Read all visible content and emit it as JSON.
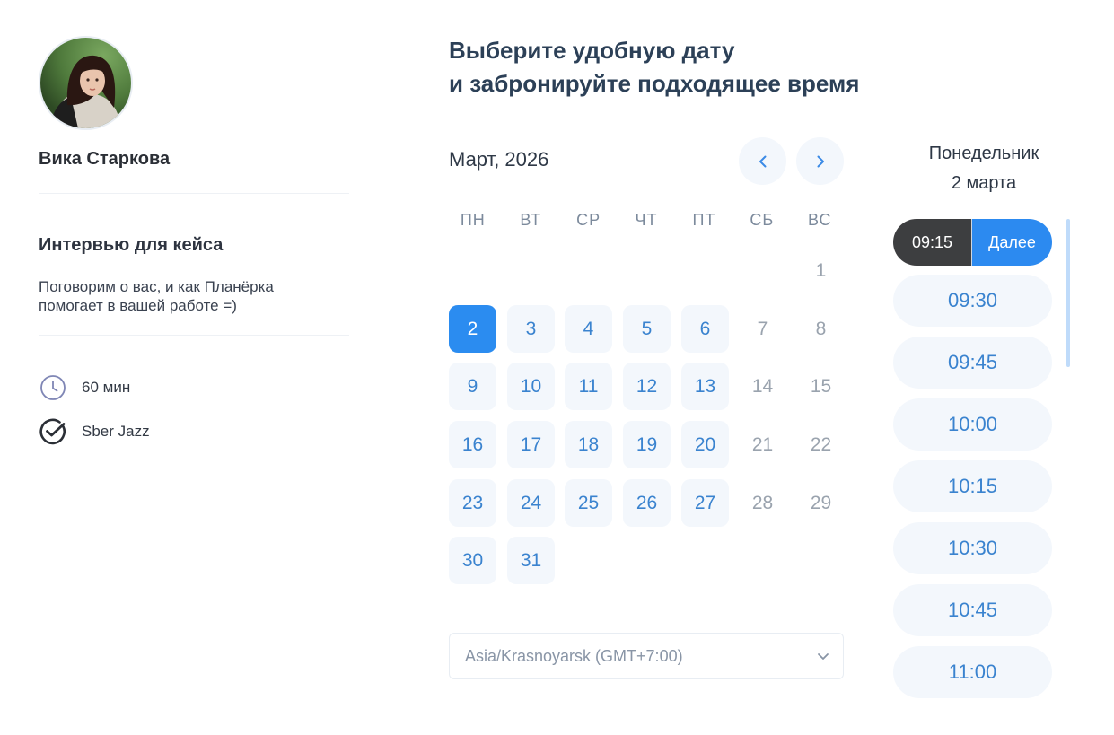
{
  "host": {
    "name": "Вика Старкова"
  },
  "event": {
    "title": "Интервью для кейса",
    "description_line1": "Поговорим о вас, и как Планёрка",
    "description_line2": "помогает в вашей работе =)",
    "duration": "60 мин",
    "platform": "Sber Jazz"
  },
  "heading": {
    "line1": "Выберите удобную дату",
    "line2": "и забронируйте подходящее время"
  },
  "calendar": {
    "month_label": "Март, 2026",
    "weekdays": [
      "ПН",
      "ВТ",
      "СР",
      "ЧТ",
      "ПТ",
      "СБ",
      "ВС"
    ],
    "selected_day": "2",
    "days": [
      {
        "label": "1",
        "col": 6,
        "row": 0,
        "state": "unavailable"
      },
      {
        "label": "2",
        "col": 0,
        "row": 1,
        "state": "selected"
      },
      {
        "label": "3",
        "col": 1,
        "row": 1,
        "state": "available"
      },
      {
        "label": "4",
        "col": 2,
        "row": 1,
        "state": "available"
      },
      {
        "label": "5",
        "col": 3,
        "row": 1,
        "state": "available"
      },
      {
        "label": "6",
        "col": 4,
        "row": 1,
        "state": "available"
      },
      {
        "label": "7",
        "col": 5,
        "row": 1,
        "state": "unavailable"
      },
      {
        "label": "8",
        "col": 6,
        "row": 1,
        "state": "unavailable"
      },
      {
        "label": "9",
        "col": 0,
        "row": 2,
        "state": "available"
      },
      {
        "label": "10",
        "col": 1,
        "row": 2,
        "state": "available"
      },
      {
        "label": "11",
        "col": 2,
        "row": 2,
        "state": "available"
      },
      {
        "label": "12",
        "col": 3,
        "row": 2,
        "state": "available"
      },
      {
        "label": "13",
        "col": 4,
        "row": 2,
        "state": "available"
      },
      {
        "label": "14",
        "col": 5,
        "row": 2,
        "state": "unavailable"
      },
      {
        "label": "15",
        "col": 6,
        "row": 2,
        "state": "unavailable"
      },
      {
        "label": "16",
        "col": 0,
        "row": 3,
        "state": "available"
      },
      {
        "label": "17",
        "col": 1,
        "row": 3,
        "state": "available"
      },
      {
        "label": "18",
        "col": 2,
        "row": 3,
        "state": "available"
      },
      {
        "label": "19",
        "col": 3,
        "row": 3,
        "state": "available"
      },
      {
        "label": "20",
        "col": 4,
        "row": 3,
        "state": "available"
      },
      {
        "label": "21",
        "col": 5,
        "row": 3,
        "state": "unavailable"
      },
      {
        "label": "22",
        "col": 6,
        "row": 3,
        "state": "unavailable"
      },
      {
        "label": "23",
        "col": 0,
        "row": 4,
        "state": "available"
      },
      {
        "label": "24",
        "col": 1,
        "row": 4,
        "state": "available"
      },
      {
        "label": "25",
        "col": 2,
        "row": 4,
        "state": "available"
      },
      {
        "label": "26",
        "col": 3,
        "row": 4,
        "state": "available"
      },
      {
        "label": "27",
        "col": 4,
        "row": 4,
        "state": "available"
      },
      {
        "label": "28",
        "col": 5,
        "row": 4,
        "state": "unavailable"
      },
      {
        "label": "29",
        "col": 6,
        "row": 4,
        "state": "unavailable"
      },
      {
        "label": "30",
        "col": 0,
        "row": 5,
        "state": "available"
      },
      {
        "label": "31",
        "col": 1,
        "row": 5,
        "state": "available"
      }
    ],
    "timezone": "Asia/Krasnoyarsk (GMT+7:00)"
  },
  "slots_panel": {
    "weekday": "Понедельник",
    "date": "2 марта",
    "selected_time": "09:15",
    "next_label": "Далее",
    "times": [
      "09:30",
      "09:45",
      "10:00",
      "10:15",
      "10:30",
      "10:45",
      "11:00"
    ]
  },
  "colors": {
    "accent": "#2b8cf0",
    "available_bg": "#f3f7fc",
    "available_text": "#3a83cf",
    "unavailable_text": "#9aa3ae",
    "selected_time_bg": "#3d3e40"
  },
  "icons": {
    "prev": "chevron-left-icon",
    "next": "chevron-right-icon",
    "duration": "clock-icon",
    "platform": "sber-check-icon",
    "timezone_dropdown": "chevron-down-icon"
  }
}
